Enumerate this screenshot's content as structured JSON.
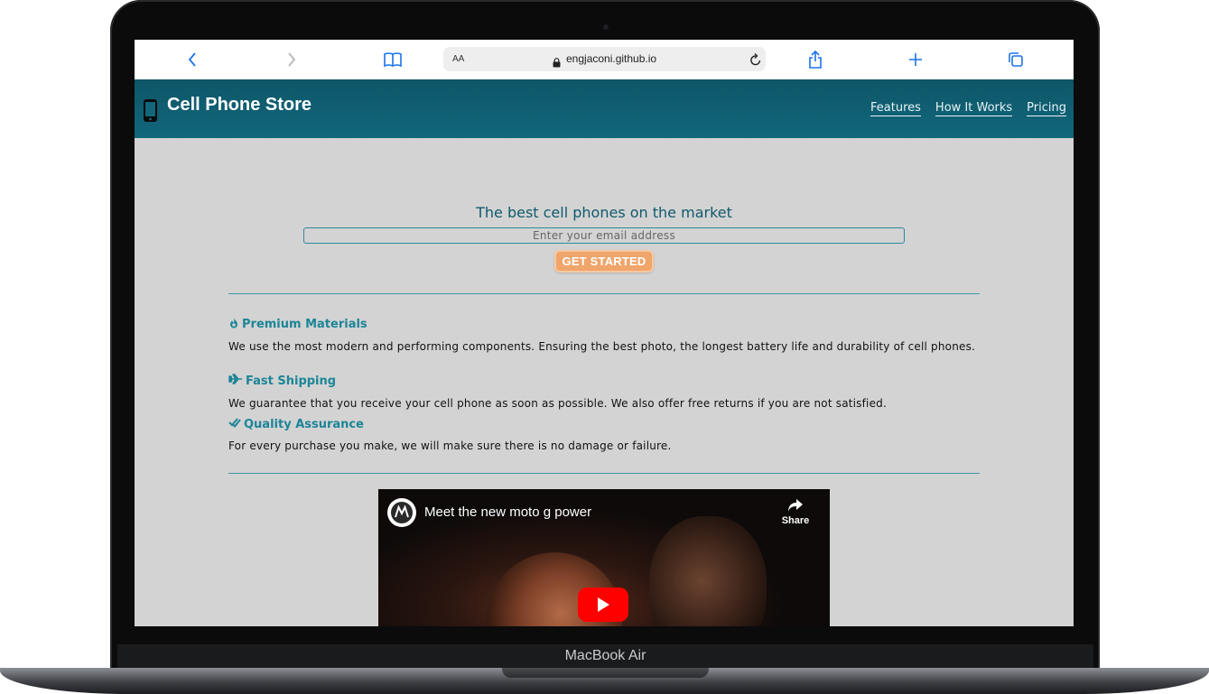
{
  "device": {
    "label": "MacBook Air"
  },
  "browser": {
    "url": "engjaconi.github.io",
    "text_size_button": "AA"
  },
  "site": {
    "title": "Cell Phone Store",
    "nav": [
      "Features",
      "How It Works",
      "Pricing"
    ]
  },
  "hero": {
    "title": "The best cell phones on the market",
    "email_placeholder": "Enter your email address",
    "cta_label": "GET STARTED"
  },
  "features": [
    {
      "icon": "fire-icon",
      "title": "Premium Materials",
      "description": "We use the most modern and performing components. Ensuring the best photo, the longest battery life and durability of cell phones."
    },
    {
      "icon": "plane-icon",
      "title": "Fast Shipping",
      "description": "We guarantee that you receive your cell phone as soon as possible. We also offer free returns if you are not satisfied."
    },
    {
      "icon": "check-double-icon",
      "title": "Quality Assurance",
      "description": "For every purchase you make, we will make sure there is no damage or failure."
    }
  ],
  "video": {
    "title": "Meet the new moto g power",
    "share_label": "Share"
  },
  "colors": {
    "header": "#12677b",
    "accent": "#1c8597",
    "cta": "#f0a56b",
    "page_bg": "#d3d3d3"
  }
}
